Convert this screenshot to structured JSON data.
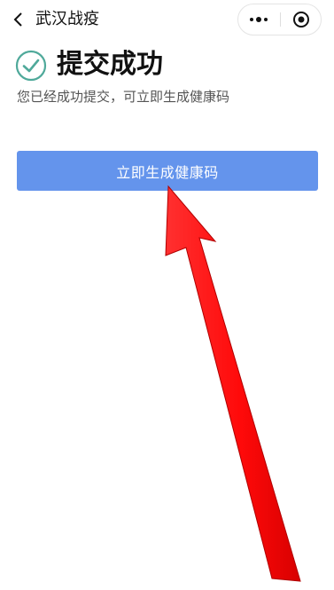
{
  "navbar": {
    "back_icon": "chevron-left-icon",
    "title": "武汉战疫",
    "more_icon": "more-dots-icon",
    "close_icon": "target-close-icon"
  },
  "success": {
    "icon": "check-circle-icon",
    "title": "提交成功",
    "description": "您已经成功提交，可立即生成健康码"
  },
  "actions": {
    "generate_label": "立即生成健康码"
  },
  "annotation": {
    "icon": "red-arrow",
    "color": "#ff1a1a"
  },
  "colors": {
    "primary_button": "#6494ec",
    "check_icon": "#4fa99a"
  }
}
